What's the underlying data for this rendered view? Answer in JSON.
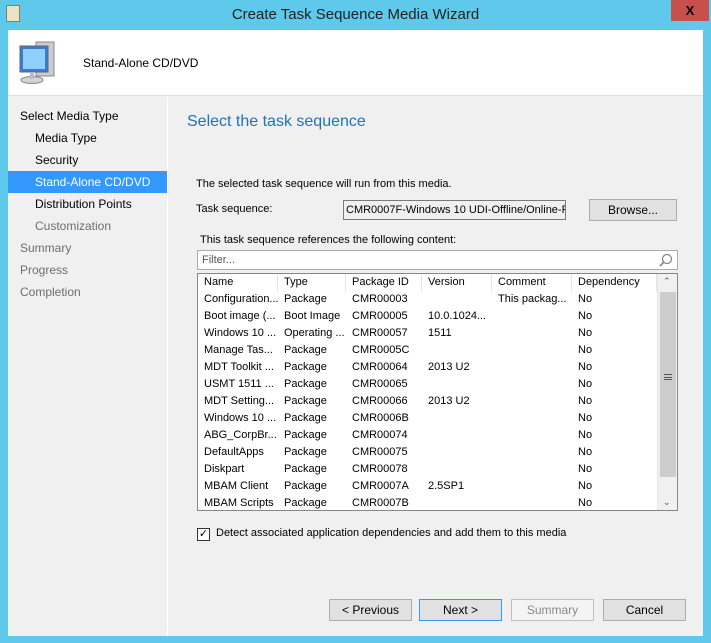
{
  "window": {
    "title": "Create Task Sequence Media Wizard",
    "close": "X"
  },
  "header": {
    "title": "Stand-Alone CD/DVD"
  },
  "nav": [
    {
      "label": "Select Media Type",
      "state": "normal",
      "level": 0
    },
    {
      "label": "Media Type",
      "state": "normal",
      "level": 1
    },
    {
      "label": "Security",
      "state": "normal",
      "level": 1
    },
    {
      "label": "Stand-Alone CD/DVD",
      "state": "selected",
      "level": 1
    },
    {
      "label": "Distribution Points",
      "state": "normal",
      "level": 1
    },
    {
      "label": "Customization",
      "state": "disabled",
      "level": 1
    },
    {
      "label": "Summary",
      "state": "disabled",
      "level": 0
    },
    {
      "label": "Progress",
      "state": "disabled",
      "level": 0
    },
    {
      "label": "Completion",
      "state": "disabled",
      "level": 0
    }
  ],
  "main": {
    "heading": "Select the task sequence",
    "info": "The selected task sequence will run from this media.",
    "ts_label": "Task sequence:",
    "ts_value": "CMR0007F-Windows 10 UDI-Offline/Online-R",
    "browse": "Browse...",
    "ref_label": "This task sequence references the following content:",
    "filter_placeholder": "Filter...",
    "columns": [
      "Name",
      "Type",
      "Package ID",
      "Version",
      "Comment",
      "Dependency"
    ],
    "rows": [
      [
        "Configuration...",
        "Package",
        "CMR00003",
        "",
        "This packag...",
        "No"
      ],
      [
        "Boot image (...",
        "Boot Image",
        "CMR00005",
        "10.0.1024...",
        "",
        "No"
      ],
      [
        "Windows 10 ...",
        "Operating ...",
        "CMR00057",
        "1511",
        "",
        "No"
      ],
      [
        "Manage Tas...",
        "Package",
        "CMR0005C",
        "",
        "",
        "No"
      ],
      [
        "MDT Toolkit ...",
        "Package",
        "CMR00064",
        "2013 U2",
        "",
        "No"
      ],
      [
        "USMT 1511 ...",
        "Package",
        "CMR00065",
        "",
        "",
        "No"
      ],
      [
        "MDT Setting...",
        "Package",
        "CMR00066",
        "2013 U2",
        "",
        "No"
      ],
      [
        "Windows 10 ...",
        "Package",
        "CMR0006B",
        "",
        "",
        "No"
      ],
      [
        "ABG_CorpBr...",
        "Package",
        "CMR00074",
        "",
        "",
        "No"
      ],
      [
        "DefaultApps",
        "Package",
        "CMR00075",
        "",
        "",
        "No"
      ],
      [
        "Diskpart",
        "Package",
        "CMR00078",
        "",
        "",
        "No"
      ],
      [
        "MBAM Client",
        "Package",
        "CMR0007A",
        "2.5SP1",
        "",
        "No"
      ],
      [
        "MBAM Scripts",
        "Package",
        "CMR0007B",
        "",
        "",
        "No"
      ]
    ],
    "checkbox_label": "Detect associated application dependencies and add them to this media",
    "checkbox_checked": true
  },
  "buttons": {
    "previous": "< Previous",
    "next": "Next >",
    "summary": "Summary",
    "cancel": "Cancel"
  }
}
